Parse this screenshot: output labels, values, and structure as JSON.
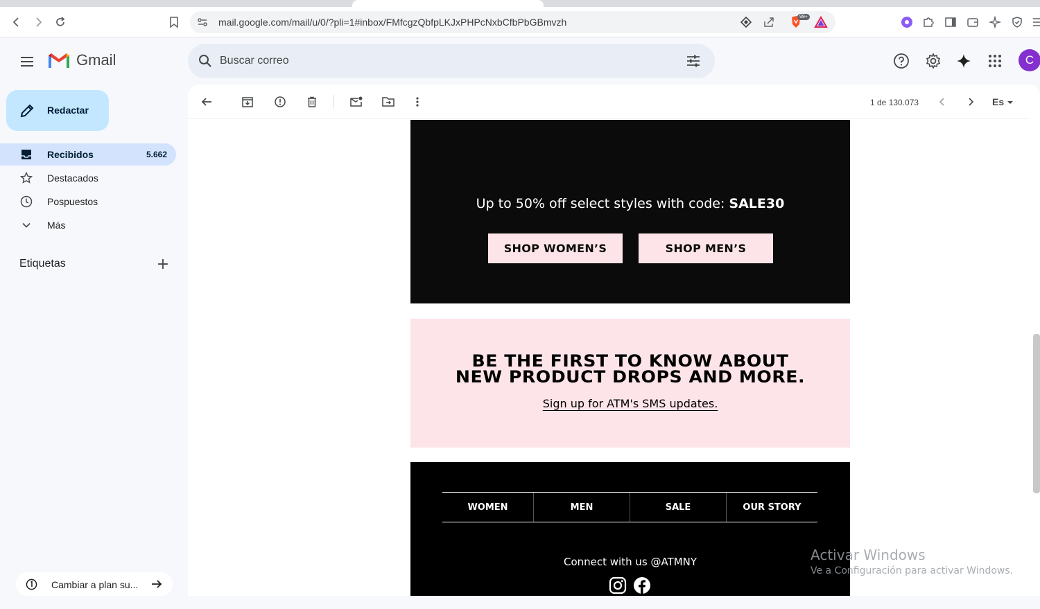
{
  "browser": {
    "url": "mail.google.com/mail/u/0/?pli=1#inbox/FMfcgzQbfpLKJxPHPcNxbCfbPbGBmvzh",
    "badge": "99+"
  },
  "app": {
    "brand": "Gmail",
    "accent_color": "#c2e7ff",
    "avatar_letter": "C",
    "avatar_color": "#8430ce"
  },
  "search": {
    "placeholder": "Buscar correo"
  },
  "sidebar": {
    "compose_label": "Redactar",
    "items": [
      {
        "label": "Recibidos",
        "count": "5.662",
        "icon": "inbox-icon",
        "active": true
      },
      {
        "label": "Destacados",
        "count": "",
        "icon": "star-icon",
        "active": false
      },
      {
        "label": "Pospuestos",
        "count": "",
        "icon": "clock-icon",
        "active": false
      },
      {
        "label": "Más",
        "count": "",
        "icon": "chevron-down-icon",
        "active": false
      }
    ],
    "labels_title": "Etiquetas",
    "upgrade_label": "Cambiar a plan su..."
  },
  "message_toolbar": {
    "pager": "1 de 130.073",
    "language": "Es"
  },
  "email": {
    "offer_text": "Up to 50% off select styles with code: ",
    "offer_code": "SALE30",
    "shop_women": "SHOP WOMEN’S",
    "shop_men": "SHOP MEN’S",
    "sms_headline_1": "BE THE FIRST TO KNOW ABOUT",
    "sms_headline_2": "NEW PRODUCT DROPS AND MORE.",
    "sms_link": "Sign up for ATM's SMS updates.",
    "footer_nav": [
      "WOMEN",
      "MEN",
      "SALE",
      "OUR STORY"
    ],
    "connect_text": "Connect with us @ATMNY",
    "promo_bg": "#0b0b0b",
    "pink": "#fde4e8"
  },
  "watermark": {
    "title": "Activar Windows",
    "subtitle": "Ve a Configuración para activar Windows."
  }
}
